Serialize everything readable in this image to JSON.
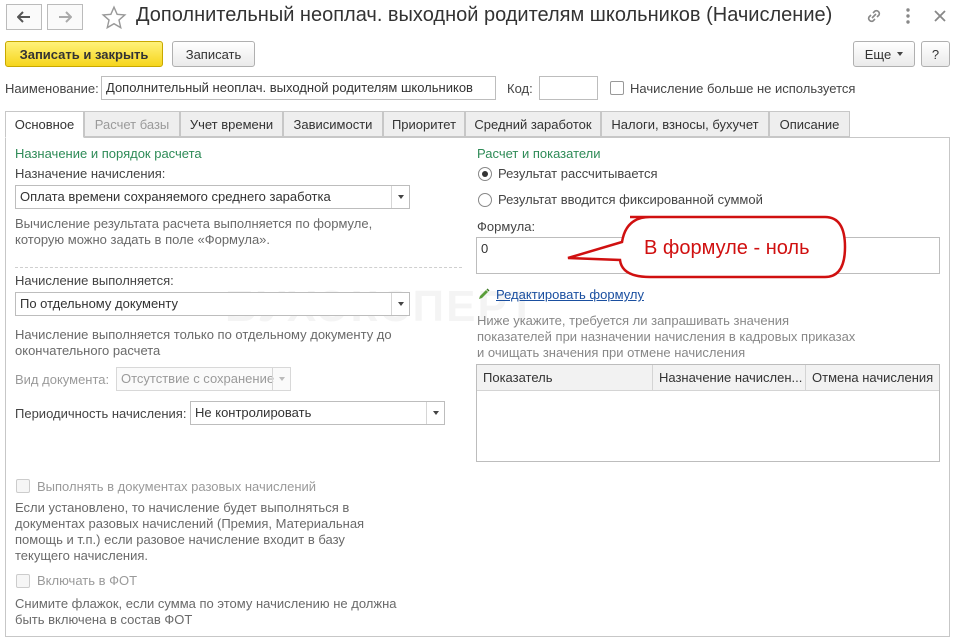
{
  "header": {
    "title": "Дополнительный неоплач. выходной родителям школьников (Начисление)"
  },
  "toolbar": {
    "save_close": "Записать и закрыть",
    "save": "Записать",
    "more": "Еще",
    "help": "?"
  },
  "top_fields": {
    "name_label": "Наименование:",
    "name_value": "Дополнительный неоплач. выходной родителям школьников",
    "code_label": "Код:",
    "code_value": "",
    "unused_label": "Начисление больше не используется"
  },
  "tabs": [
    {
      "label": "Основное"
    },
    {
      "label": "Расчет базы"
    },
    {
      "label": "Учет времени"
    },
    {
      "label": "Зависимости"
    },
    {
      "label": "Приоритет"
    },
    {
      "label": "Средний заработок"
    },
    {
      "label": "Налоги, взносы, бухучет"
    },
    {
      "label": "Описание"
    }
  ],
  "left": {
    "section_title": "Назначение и порядок расчета",
    "purpose_label": "Назначение начисления:",
    "purpose_value": "Оплата времени сохраняемого среднего заработка",
    "purpose_hint_1": "Вычисление результата расчета выполняется по формуле,",
    "purpose_hint_2": "которую можно задать в поле «Формула».",
    "performed_label": "Начисление выполняется:",
    "performed_value": "По отдельному документу",
    "performed_hint_1": "Начисление выполняется только по отдельному документу до",
    "performed_hint_2": "окончательного расчета",
    "doctype_label": "Вид документа:",
    "doctype_value": "Отсутствие с сохранение",
    "period_label": "Периодичность начисления:",
    "period_value": "Не контролировать",
    "oneoff_label": "Выполнять в документах разовых начислений",
    "oneoff_hint_1": "Если установлено, то начисление будет выполняться в",
    "oneoff_hint_2": "документах разовых начислений (Премия, Материальная",
    "oneoff_hint_3": "помощь и т.п.) если разовое начисление входит в базу",
    "oneoff_hint_4": "текущего начисления.",
    "fot_label": "Включать в ФОТ",
    "fot_hint_1": "Снимите флажок, если сумма по этому начислению не должна",
    "fot_hint_2": "быть включена в состав ФОТ"
  },
  "right": {
    "section_title": "Расчет и показатели",
    "radio_calc": "Результат рассчитывается",
    "radio_fixed": "Результат вводится фиксированной суммой",
    "formula_label": "Формула:",
    "formula_value": "0",
    "edit_formula": "Редактировать формулу",
    "hint_1": "Ниже укажите, требуется ли запрашивать значения",
    "hint_2": "показателей при назначении начисления в кадровых приказах",
    "hint_3": "и очищать значения при отмене начисления",
    "table_headers": [
      "Показатель",
      "Назначение начислен...",
      "Отмена начисления"
    ]
  },
  "watermark": "БУХЭКСПЕРТ",
  "callout": {
    "text": "В формуле - ноль",
    "color": "#d01010"
  }
}
